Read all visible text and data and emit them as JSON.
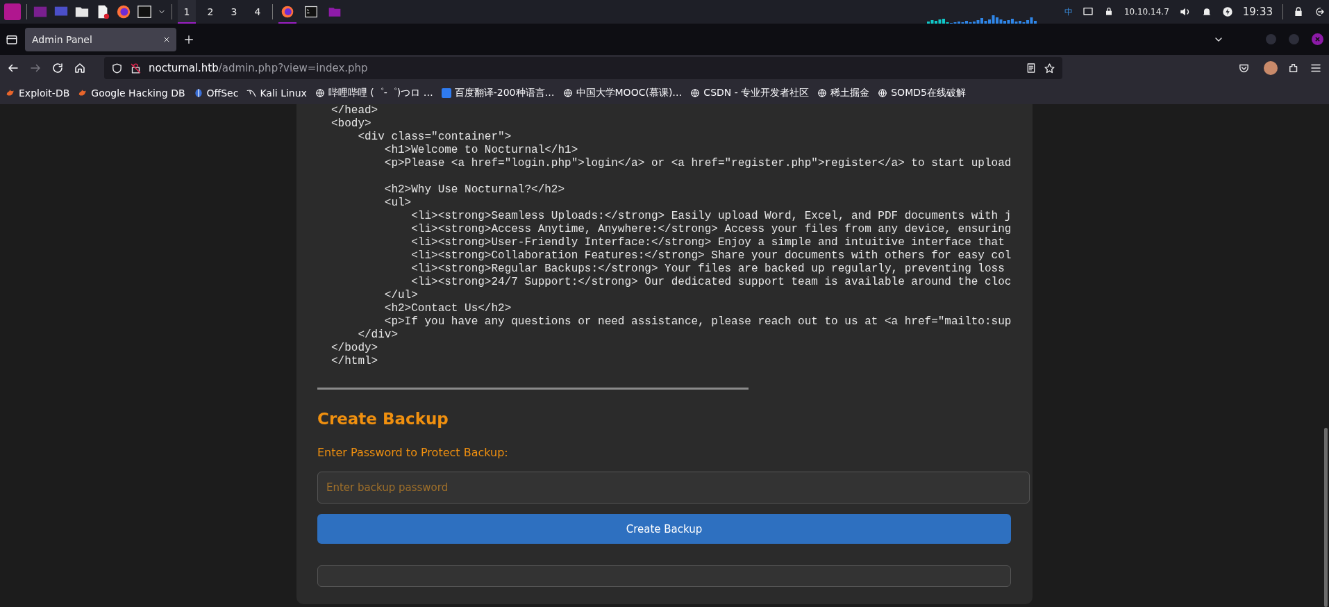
{
  "taskbar": {
    "workspaces": [
      {
        "label": "1",
        "selected": true
      },
      {
        "label": "2",
        "selected": false
      },
      {
        "label": "3",
        "selected": false
      },
      {
        "label": "4",
        "selected": false
      }
    ],
    "windows": [
      {
        "kind": "browser",
        "active": true
      },
      {
        "kind": "terminal",
        "active": false
      },
      {
        "kind": "folder",
        "active": false
      }
    ],
    "input_method": "中",
    "ip_address": "10.10.14.7",
    "clock": "19:33"
  },
  "tabs": [
    {
      "title": "Admin Panel",
      "selected": true
    }
  ],
  "nav_buttons": [
    {
      "kind": "back",
      "disabled": false
    },
    {
      "kind": "forward",
      "disabled": true
    },
    {
      "kind": "reload",
      "disabled": false
    },
    {
      "kind": "home",
      "disabled": false
    }
  ],
  "url": {
    "host": "nocturnal.htb",
    "path": "/admin.php?view=index.php"
  },
  "bookmarks": [
    {
      "kind": "flame",
      "label": "Exploit-DB"
    },
    {
      "kind": "flame",
      "label": "Google Hacking DB"
    },
    {
      "kind": "offsec",
      "label": "OffSec"
    },
    {
      "kind": "kali",
      "label": "Kali Linux"
    },
    {
      "kind": "globe",
      "label": "哔哩哔哩 (゜-゜)つロ …"
    },
    {
      "kind": "translate",
      "label": "百度翻译-200种语言…"
    },
    {
      "kind": "globe",
      "label": "中国大学MOOC(慕课)…"
    },
    {
      "kind": "globe",
      "label": "CSDN - 专业开发者社区"
    },
    {
      "kind": "globe",
      "label": "稀土掘金"
    },
    {
      "kind": "globe",
      "label": "SOMD5在线破解"
    }
  ],
  "source_code": "</head>\n<body>\n    <div class=\"container\">\n        <h1>Welcome to Nocturnal</h1>\n        <p>Please <a href=\"login.php\">login</a> or <a href=\"register.php\">register</a> to start upload\n\n        <h2>Why Use Nocturnal?</h2>\n        <ul>\n            <li><strong>Seamless Uploads:</strong> Easily upload Word, Excel, and PDF documents with j\n            <li><strong>Access Anytime, Anywhere:</strong> Access your files from any device, ensuring\n            <li><strong>User-Friendly Interface:</strong> Enjoy a simple and intuitive interface that\n            <li><strong>Collaboration Features:</strong> Share your documents with others for easy col\n            <li><strong>Regular Backups:</strong> Your files are backed up regularly, preventing loss\n            <li><strong>24/7 Support:</strong> Our dedicated support team is available around the cloc\n        </ul>\n        <h2>Contact Us</h2>\n        <p>If you have any questions or need assistance, please reach out to us at <a href=\"mailto:sup\n    </div>\n</body>\n</html>",
  "backup": {
    "heading": "Create Backup",
    "label": "Enter Password to Protect Backup:",
    "placeholder": "Enter backup password",
    "button": "Create Backup"
  }
}
